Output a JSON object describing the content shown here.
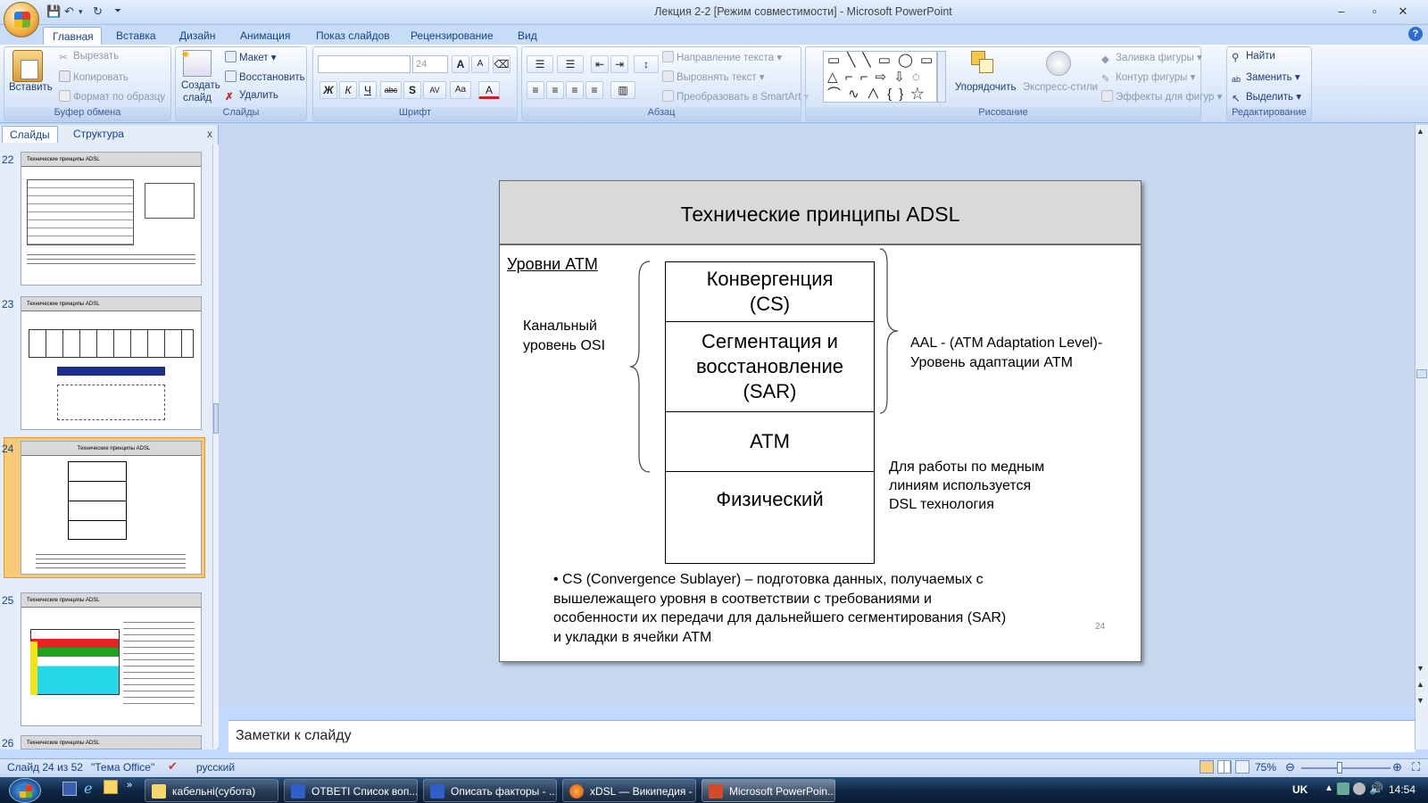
{
  "window": {
    "title": "Лекция 2-2 [Режим совместимости] - Microsoft PowerPoint"
  },
  "quick_access": {
    "undo_arrow": "▾"
  },
  "tabs": [
    "Главная",
    "Вставка",
    "Дизайн",
    "Анимация",
    "Показ слайдов",
    "Рецензирование",
    "Вид"
  ],
  "ribbon": {
    "clipboard": {
      "label": "Буфер обмена",
      "paste": "Вставить",
      "cut": "Вырезать",
      "copy": "Копировать",
      "format_painter": "Формат по образцу"
    },
    "slides": {
      "label": "Слайды",
      "new_slide_line1": "Создать",
      "new_slide_line2": "слайд",
      "layout": "Макет",
      "reset": "Восстановить",
      "delete": "Удалить"
    },
    "font": {
      "label": "Шрифт",
      "font_size": "24",
      "bold": "Ж",
      "italic": "К",
      "underline": "Ч",
      "strike": "abc",
      "shadow": "S",
      "spacing": "AV",
      "case": "Aa",
      "color": "A",
      "grow": "A",
      "shrink": "A"
    },
    "paragraph": {
      "label": "Абзац",
      "text_direction": "Направление текста",
      "align_text": "Выровнять текст",
      "smartart": "Преобразовать в SmartArt"
    },
    "drawing": {
      "label": "Рисование",
      "arrange": "Упорядочить",
      "quick_styles": "Экспресс-стили",
      "shape_fill": "Заливка фигуры",
      "shape_outline": "Контур фигуры",
      "shape_effects": "Эффекты для фигур"
    },
    "editing": {
      "label": "Редактирование",
      "find": "Найти",
      "replace": "Заменить",
      "select": "Выделить"
    }
  },
  "left_pane": {
    "tab_slides": "Слайды",
    "tab_outline": "Структура",
    "close": "x",
    "thumbnails": [
      {
        "number": "22",
        "title": "Технические принципы ADSL"
      },
      {
        "number": "23",
        "title": "Технические принципы ADSL"
      },
      {
        "number": "24",
        "title": "Технические принципы ADSL"
      },
      {
        "number": "25",
        "title": "Технические принципы ADSL"
      },
      {
        "number": "26",
        "title": "Технические принципы ADSL"
      }
    ]
  },
  "slide": {
    "title": "Технические принципы ADSL",
    "atm_levels": "Уровни ATM",
    "osi_label_line1": "Канальный",
    "osi_label_line2": "уровень OSI",
    "layers": [
      {
        "line1": "Конвергенция",
        "line2": "(CS)"
      },
      {
        "line1": "Сегментация и",
        "line2": "восстановление",
        "line3": "(SAR)"
      },
      {
        "line1": "ATM"
      },
      {
        "line1": "Физический"
      }
    ],
    "aal_line1": "AAL - (ATM Adaptation Level)-",
    "aal_line2": "Уровень адаптации ATM",
    "dsl_line1": "Для работы по медным",
    "dsl_line2": "линиям используется",
    "dsl_line3": "DSL технология",
    "bullet_line1": "• CS (Convergence  Sublayer) – подготовка данных, получаемых с",
    "bullet_line2": "вышележащего уровня в соответствии с требованиями и",
    "bullet_line3": "особенности их передачи для дальнейшего сегментирования (SAR)",
    "bullet_line4": "и укладки в ячейки ATM",
    "page_number": "24"
  },
  "notes": {
    "placeholder": "Заметки к слайду"
  },
  "status": {
    "slide_info": "Слайд 24 из 52",
    "theme": "\"Тема Office\"",
    "language": "русский",
    "zoom": "75%"
  },
  "taskbar": {
    "items": [
      "кабельні(субота)",
      "ОТВЕТІ Список воп...",
      "Описать факторы - ...",
      "xDSL — Википедия - ...",
      "Microsoft PowerPoin..."
    ],
    "lang": "UK",
    "time": "14:54"
  },
  "colors": {
    "ribbon_bg": "#dbe8fa",
    "slide_title_bg": "#d9d9d9",
    "taskbar": "#0f2745"
  }
}
